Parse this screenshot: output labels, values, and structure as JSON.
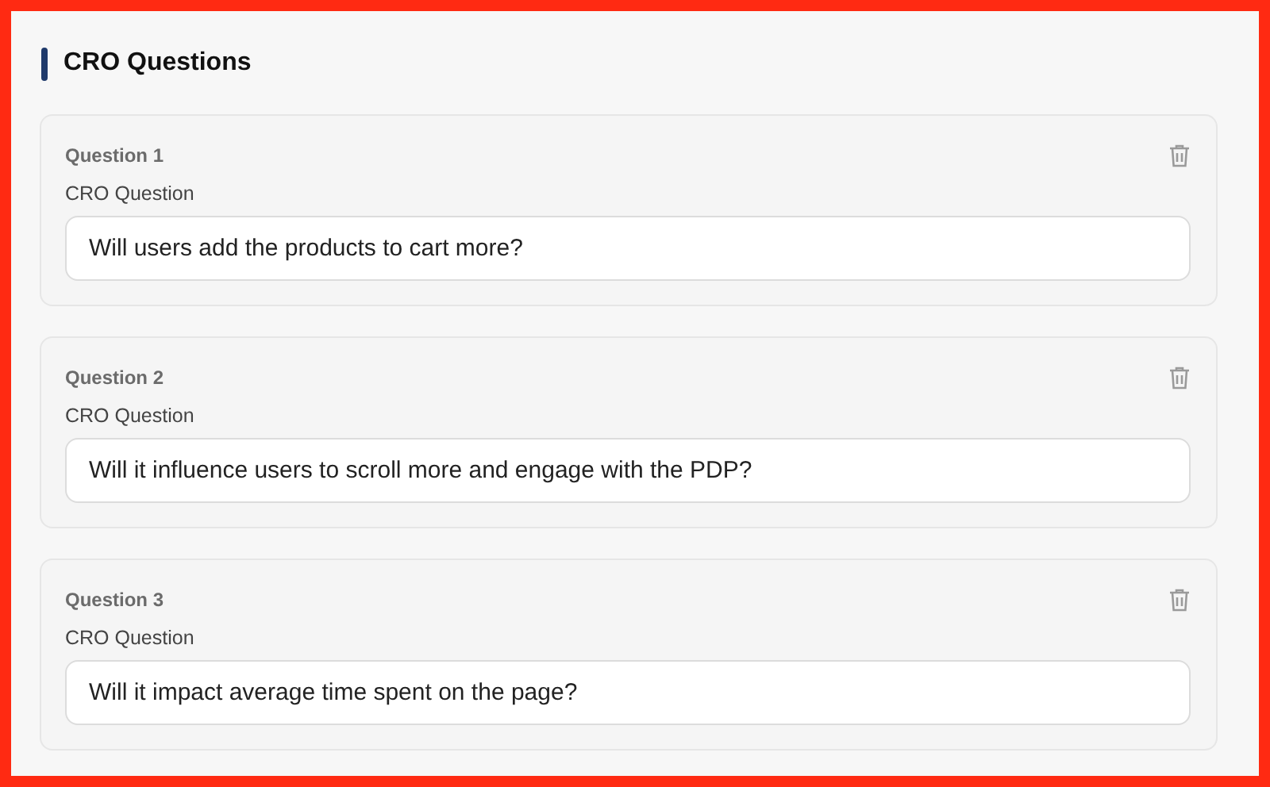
{
  "section": {
    "title": "CRO Questions"
  },
  "questions": [
    {
      "heading": "Question 1",
      "label": "CRO Question",
      "value": "Will users add the products to cart more?"
    },
    {
      "heading": "Question 2",
      "label": "CRO Question",
      "value": "Will it influence users to scroll more and engage with the PDP?"
    },
    {
      "heading": "Question 3",
      "label": "CRO Question",
      "value": "Will it impact average time spent on the page?"
    }
  ]
}
